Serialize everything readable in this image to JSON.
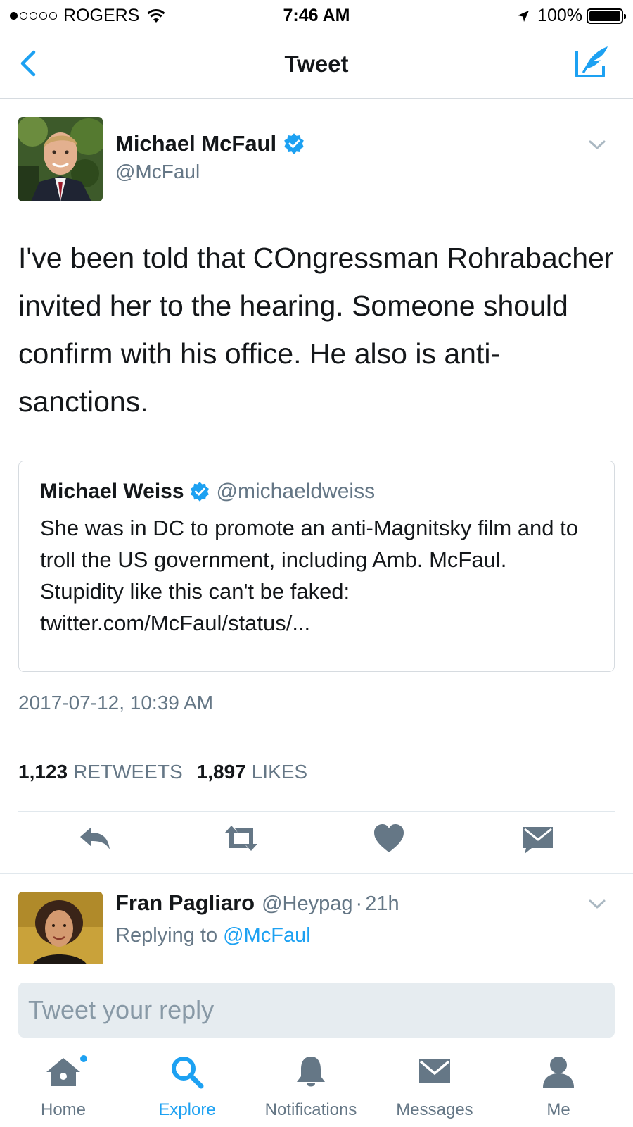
{
  "status_bar": {
    "carrier": "ROGERS",
    "time": "7:46 AM",
    "battery": "100%",
    "battery_level": 1.0,
    "signal_bars_filled": 1,
    "signal_bars_total": 5
  },
  "nav": {
    "title": "Tweet",
    "back_icon": "chevron-left-icon",
    "compose_icon": "compose-icon"
  },
  "tweet": {
    "author_name": "Michael McFaul",
    "author_handle": "@McFaul",
    "verified": true,
    "text": "I've been told that COngressman Rohrabacher invited her to the hearing. Someone should confirm with his office. He also is anti-sanctions.",
    "quoted": {
      "author_name": "Michael Weiss",
      "author_handle": "@michaeldweiss",
      "verified": true,
      "text": "She was in DC to promote an anti-Magnitsky film and to troll the US government, including Amb. McFaul. Stupidity like this can't be faked: twitter.com/McFaul/status/..."
    },
    "timestamp": "2017-07-12, 10:39 AM",
    "retweets_count": "1,123",
    "retweets_label": "RETWEETS",
    "likes_count": "1,897",
    "likes_label": "LIKES"
  },
  "actions": [
    "reply-icon",
    "retweet-icon",
    "heart-icon",
    "direct-message-icon"
  ],
  "reply": {
    "author_name": "Fran Pagliaro",
    "author_handle": "@Heypag",
    "time_ago": "21h",
    "replying_prefix": "Replying to",
    "replying_to": "@McFaul"
  },
  "composer": {
    "placeholder": "Tweet your reply"
  },
  "tabbar": {
    "items": [
      {
        "label": "Home",
        "icon": "home-icon",
        "active": false,
        "badge": true
      },
      {
        "label": "Explore",
        "icon": "search-icon",
        "active": true,
        "badge": false
      },
      {
        "label": "Notifications",
        "icon": "bell-icon",
        "active": false,
        "badge": false
      },
      {
        "label": "Messages",
        "icon": "envelope-icon",
        "active": false,
        "badge": false
      },
      {
        "label": "Me",
        "icon": "person-icon",
        "active": false,
        "badge": false
      }
    ]
  },
  "colors": {
    "accent": "#1da1f2",
    "text": "#14171a",
    "secondary_text": "#657786",
    "icon_gray": "#657786",
    "border": "#e1e8ed"
  }
}
